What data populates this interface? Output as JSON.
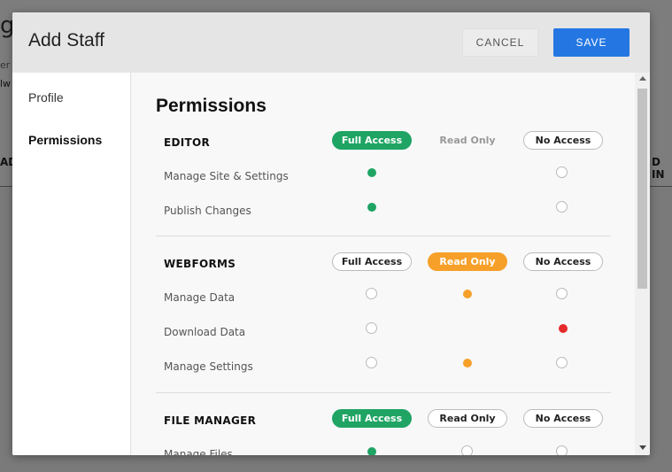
{
  "background": {
    "heading_fragment": "g",
    "sub1_fragment": "er l",
    "sub2_fragment": "lw",
    "col_left_fragment": "AD",
    "col_right_fragment": "D IN"
  },
  "modal": {
    "title": "Add Staff",
    "cancel_label": "CANCEL",
    "save_label": "SAVE"
  },
  "sidebar": {
    "items": [
      {
        "label": "Profile",
        "active": false
      },
      {
        "label": "Permissions",
        "active": true
      }
    ]
  },
  "permissions": {
    "title": "Permissions",
    "options": [
      "Full Access",
      "Read Only",
      "No Access"
    ],
    "sections": [
      {
        "label": "EDITOR",
        "selected": "Full Access",
        "rows": [
          {
            "label": "Manage Site & Settings",
            "value": "Full Access"
          },
          {
            "label": "Publish Changes",
            "value": "Full Access"
          }
        ]
      },
      {
        "label": "WEBFORMS",
        "selected": "Read Only",
        "rows": [
          {
            "label": "Manage Data",
            "value": "Read Only"
          },
          {
            "label": "Download Data",
            "value": "No Access"
          },
          {
            "label": "Manage Settings",
            "value": "Read Only"
          }
        ]
      },
      {
        "label": "FILE MANAGER",
        "selected": "Full Access",
        "rows": [
          {
            "label": "Manage Files",
            "value": "Full Access"
          }
        ]
      }
    ]
  },
  "colors": {
    "full_access": "#1fa463",
    "read_only": "#f6a02a",
    "no_access_selected": "#e52b2b",
    "save_button": "#2477e2"
  }
}
